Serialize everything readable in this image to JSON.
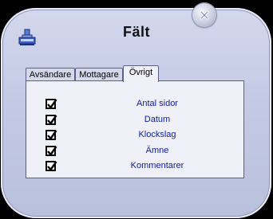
{
  "window": {
    "title": "Fält"
  },
  "tabs": [
    {
      "label": "Avsändare",
      "active": false
    },
    {
      "label": "Mottagare",
      "active": false
    },
    {
      "label": "Övrigt",
      "active": true
    }
  ],
  "fields": [
    {
      "label": "Antal sidor",
      "checked": true
    },
    {
      "label": "Datum",
      "checked": true
    },
    {
      "label": "Klockslag",
      "checked": true
    },
    {
      "label": "Ämne",
      "checked": true
    },
    {
      "label": "Kommentarer",
      "checked": true
    }
  ],
  "colors": {
    "label_text": "#0b1ba7",
    "window_bg": "#c4cae4",
    "panel_bg": "#f0f1f8"
  },
  "icons": {
    "app": "fax-stamp-icon",
    "close": "close-icon",
    "check": "checkmark-icon"
  }
}
